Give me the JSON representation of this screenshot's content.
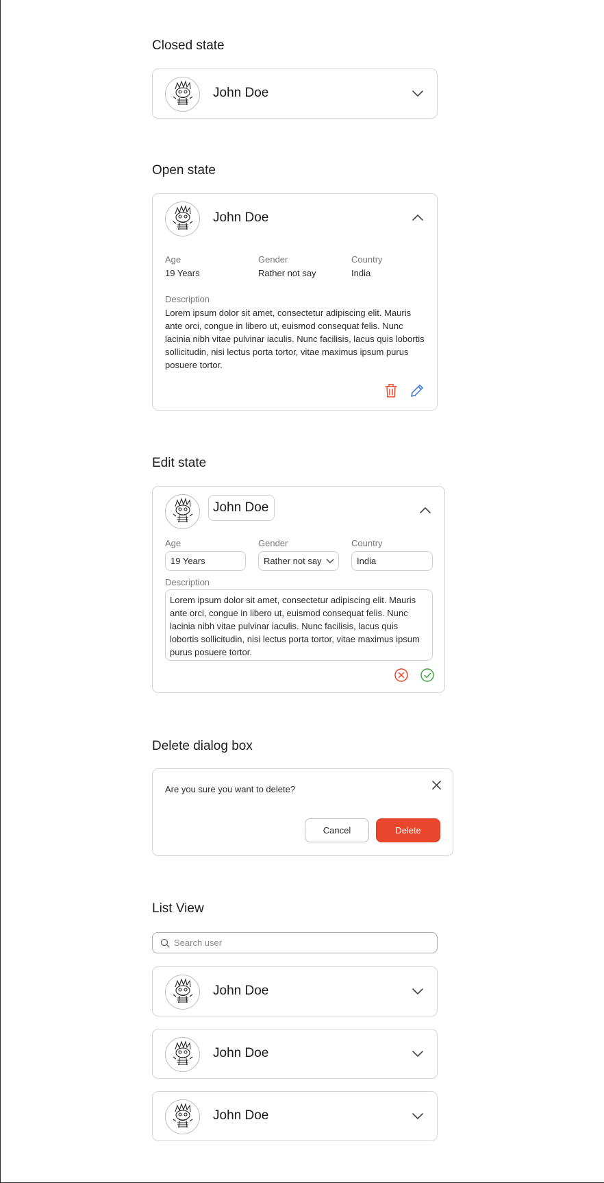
{
  "sections": {
    "closed": "Closed state",
    "open": "Open state",
    "edit": "Edit state",
    "delete": "Delete dialog box",
    "list": "List View"
  },
  "user": {
    "name": "John Doe",
    "age_label": "Age",
    "age": "19 Years",
    "gender_label": "Gender",
    "gender": "Rather not say",
    "country_label": "Country",
    "country": "India",
    "description_label": "Description",
    "description": "Lorem ipsum dolor sit amet, consectetur adipiscing elit. Mauris ante orci, congue in libero ut, euismod consequat felis. Nunc lacinia nibh vitae pulvinar iaculis. Nunc facilisis, lacus quis lobortis sollicitudin, nisi lectus porta tortor, vitae maximus ipsum purus posuere tortor."
  },
  "dialog": {
    "message": "Are you sure you want to delete?",
    "cancel_label": "Cancel",
    "delete_label": "Delete"
  },
  "search": {
    "placeholder": "Search user"
  },
  "list": [
    {
      "name": "John Doe"
    },
    {
      "name": "John Doe"
    },
    {
      "name": "John Doe"
    }
  ],
  "colors": {
    "danger": "#e8472b",
    "edit_blue": "#2f6fe3",
    "confirm_green": "#3aa63a",
    "border": "#d6d6d6"
  }
}
